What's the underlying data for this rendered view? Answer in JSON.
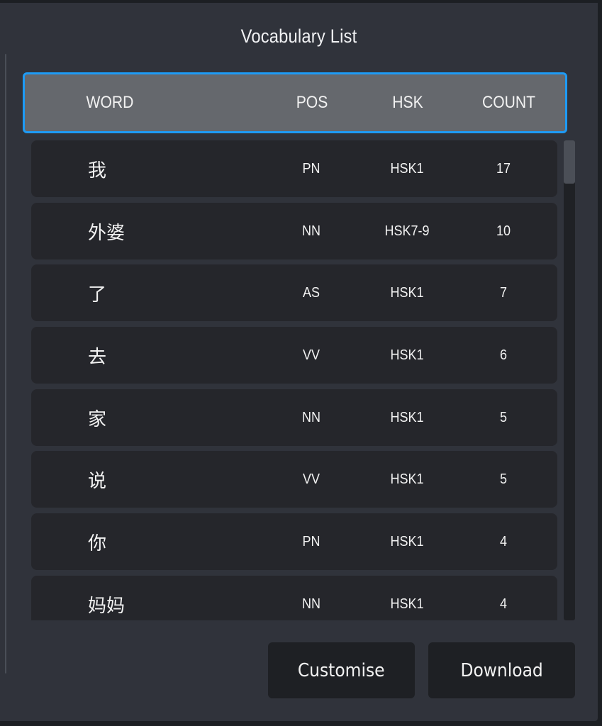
{
  "title": "Vocabulary List",
  "columns": {
    "word": "WORD",
    "pos": "POS",
    "hsk": "HSK",
    "count": "COUNT"
  },
  "rows": [
    {
      "word": "我",
      "pos": "PN",
      "hsk": "HSK1",
      "count": "17"
    },
    {
      "word": "外婆",
      "pos": "NN",
      "hsk": "HSK7-9",
      "count": "10"
    },
    {
      "word": "了",
      "pos": "AS",
      "hsk": "HSK1",
      "count": "7"
    },
    {
      "word": "去",
      "pos": "VV",
      "hsk": "HSK1",
      "count": "6"
    },
    {
      "word": "家",
      "pos": "NN",
      "hsk": "HSK1",
      "count": "5"
    },
    {
      "word": "说",
      "pos": "VV",
      "hsk": "HSK1",
      "count": "5"
    },
    {
      "word": "你",
      "pos": "PN",
      "hsk": "HSK1",
      "count": "4"
    },
    {
      "word": "妈妈",
      "pos": "NN",
      "hsk": "HSK1",
      "count": "4"
    }
  ],
  "scroll": {
    "position_fraction": 0.0,
    "visible_fraction": 0.09
  },
  "buttons": {
    "customise": "Customise",
    "download": "Download"
  },
  "colors": {
    "accent": "#1e9bf5",
    "panel": "#30333b",
    "row": "#25262b",
    "header": "#65686d"
  }
}
